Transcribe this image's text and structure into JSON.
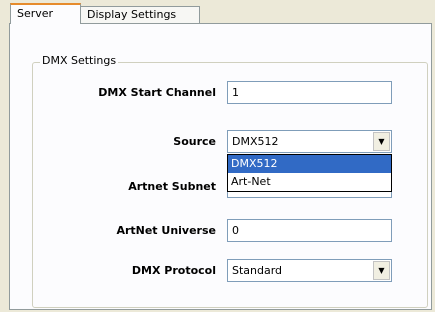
{
  "tabs": [
    {
      "label": "Server",
      "active": true
    },
    {
      "label": "Display Settings",
      "active": false
    }
  ],
  "group_title": "DMX Settings",
  "fields": {
    "start_channel": {
      "label": "DMX Start Channel",
      "value": "1"
    },
    "source": {
      "label": "Source",
      "value": "DMX512"
    },
    "artnet_subnet": {
      "label": "Artnet Subnet",
      "value": ""
    },
    "artnet_universe": {
      "label": "ArtNet Universe",
      "value": "0"
    },
    "protocol": {
      "label": "DMX Protocol",
      "value": "Standard"
    }
  },
  "source_options": [
    "DMX512",
    "Art-Net"
  ],
  "colors": {
    "selection": "#316ac5",
    "background": "#ece9d8",
    "tab_accent": "#e68b2c"
  },
  "icons": {
    "dropdown_arrow": "chevron-down-icon"
  }
}
